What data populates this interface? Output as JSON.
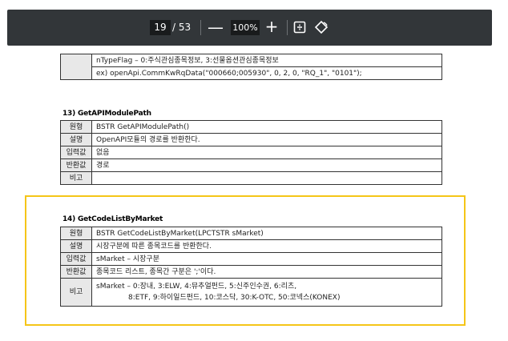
{
  "toolbar": {
    "current_page": "19",
    "total_pages": "/ 53",
    "zoom": "100%",
    "minus": "—",
    "plus": "+"
  },
  "top_table": {
    "line1": "nTypeFlag – 0:주식관심종목정보, 3:선물옵션관심종목정보",
    "line2": "ex) openApi.CommKwRqData(\"000660;005930\", 0, 2, 0, \"RQ_1\", \"0101\");"
  },
  "section13": {
    "title": "13) GetAPIModulePath",
    "rows": [
      {
        "key": "원형",
        "value": "BSTR GetAPIModulePath()"
      },
      {
        "key": "설명",
        "value": "OpenAPI모듈의 경로를 반환한다."
      },
      {
        "key": "입력값",
        "value": "없음"
      },
      {
        "key": "반환값",
        "value": "경로"
      },
      {
        "key": "비고",
        "value": ""
      }
    ]
  },
  "section14": {
    "title": "14) GetCodeListByMarket",
    "rows": [
      {
        "key": "원형",
        "value": "BSTR GetCodeListByMarket(LPCTSTR sMarket)"
      },
      {
        "key": "설명",
        "value": "시장구분에 따른 종목코드를 반환한다."
      },
      {
        "key": "입력값",
        "value": "sMarket – 시장구분"
      },
      {
        "key": "반환값",
        "value": "종목코드 리스트, 종목간 구분은 ';'이다."
      }
    ],
    "note_key": "비고",
    "note_line1": "sMarket – 0:장내,   3:ELW,   4:뮤추얼펀드,   5:신주인수권,   6:리츠,",
    "note_line2": "8:ETF,   9:하이일드펀드,   10:코스닥,   30:K-OTC, 50:코넥스(KONEX)"
  }
}
